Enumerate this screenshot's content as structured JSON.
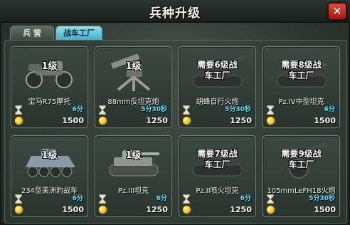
{
  "window": {
    "title": "兵种升级",
    "close_label": "✕"
  },
  "tabs": [
    {
      "label": "兵 营",
      "active": false
    },
    {
      "label": "战车工厂",
      "active": true
    }
  ],
  "cards": [
    {
      "name": "宝马R75摩托",
      "overlay": "1级",
      "time": "6分",
      "cost": "1500",
      "icon": "motorcycle-icon"
    },
    {
      "name": "88mm反坦克炮",
      "overlay": "1级",
      "time": "5分30秒",
      "cost": "1250",
      "icon": "anti-tank-gun-icon"
    },
    {
      "name": "胡蜂自行火炮",
      "overlay_line1": "需要6级战",
      "overlay_line2": "车工厂",
      "time": "5分30秒",
      "cost": "1250",
      "icon": "self-propelled-artillery-icon"
    },
    {
      "name": "Pz.IV中型坦克",
      "overlay_line1": "需要8级战",
      "overlay_line2": "车工厂",
      "time": "6分",
      "cost": "1500",
      "icon": "medium-tank-icon"
    },
    {
      "name": "234型美洲豹战车",
      "overlay": "1级",
      "time": "6分",
      "cost": "1500",
      "icon": "armored-car-icon"
    },
    {
      "name": "Pz.III坦克",
      "overlay": "1级",
      "time": "6分",
      "cost": "1250",
      "icon": "light-tank-icon"
    },
    {
      "name": "Pz.II喷火坦克",
      "overlay_line1": "需要7级战",
      "overlay_line2": "车工厂",
      "time": "6分",
      "cost": "1250",
      "icon": "flame-tank-icon"
    },
    {
      "name": "105mmLeFH18火炮",
      "overlay_line1": "需要9级战",
      "overlay_line2": "车工厂",
      "time": "5分30秒",
      "cost": "1500",
      "icon": "howitzer-icon"
    }
  ],
  "colors": {
    "accent_tab": "#3aaec9",
    "time_text": "#63dbef",
    "close": "#c8281a"
  }
}
